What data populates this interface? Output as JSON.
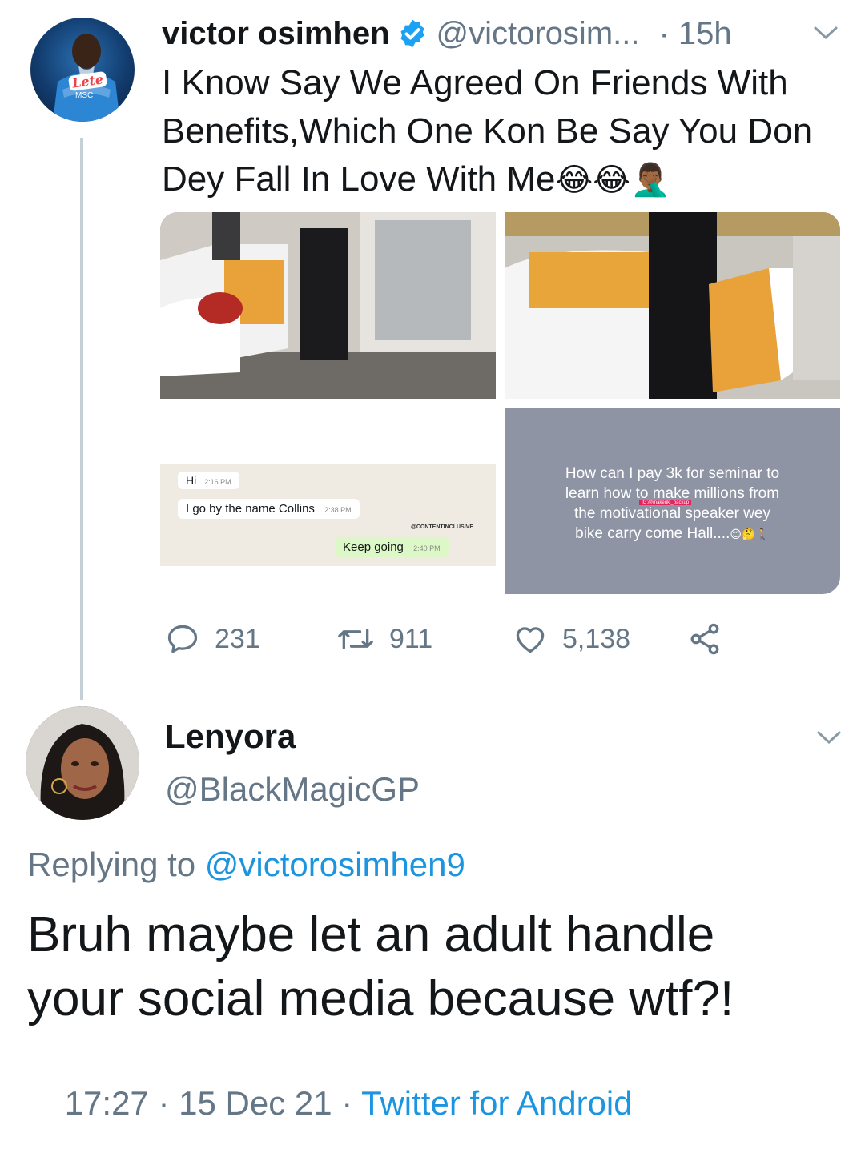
{
  "tweet": {
    "author_name": "victor osimhen",
    "author_handle": "@victorosim...",
    "time": "· 15h",
    "text_line1": "I Know Say We Agreed On Friends With",
    "text_line2": "Benefits,Which One Kon Be Say You Don",
    "text_line3": "Dey Fall In Love With Me",
    "text_emojis": "😂😂🤦🏾‍♂️",
    "avatar_text_sponsor": "Lete",
    "avatar_text_msc": "MSC",
    "media": {
      "chat": {
        "msg1": "Hi",
        "msg1_time": "2:16 PM",
        "msg2": "I go by the name Collins",
        "msg2_time": "2:38 PM",
        "watermark": "@CONTENTINCLUSIVE",
        "reply": "Keep going",
        "reply_time": "2:40 PM"
      },
      "meme": {
        "line1": "How can I pay 3k for seminar to",
        "line2": "learn how to make millions from",
        "line3": "the motivational speaker wey",
        "line4": "bike carry come Hall....",
        "line4_emoji": "😊🤔🚶",
        "watermark": "IG:@makeuki_backup"
      }
    },
    "actions": {
      "replies": "231",
      "retweets": "911",
      "likes": "5,138"
    }
  },
  "reply": {
    "author_name": "Lenyora",
    "author_handle": "@BlackMagicGP",
    "replying_to_label": "Replying to",
    "replying_to_handle": "@victorosimhen9",
    "text_line1": "Bruh maybe let an adult handle",
    "text_line2": "your social media because wtf?!",
    "timestamp": "17:27 · 15 Dec 21 · ",
    "source": "Twitter for Android"
  },
  "colors": {
    "link": "#1b95e0",
    "muted": "#657786",
    "verified": "#1da1f2",
    "thread_line": "#c4cfd6"
  }
}
